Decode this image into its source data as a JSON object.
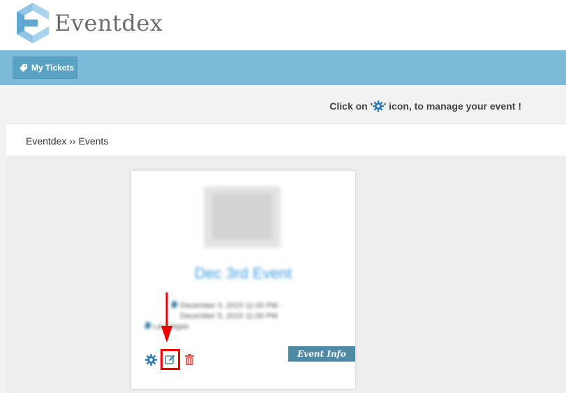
{
  "brand": {
    "name": "Eventdex",
    "colors": {
      "logo_light": "#a9d3ec",
      "logo_dark": "#5fa7d0",
      "nav": "#7dbad8",
      "button": "#5aa2c4",
      "event_info": "#4e89a6",
      "highlight": "#ee0000"
    }
  },
  "nav": {
    "my_tickets_label": "My Tickets",
    "my_tickets_icon": "ticket-icon"
  },
  "hint": {
    "prefix": "Click on '",
    "icon": "gear-icon",
    "suffix": "' icon, to manage your event !"
  },
  "breadcrumb": {
    "text": "Eventdex ›› Events"
  },
  "event_card": {
    "title": "Dec 3rd Event",
    "date_range_line1": "December 3, 2015 11:00 PM -",
    "date_range_line2": "December 5, 2015 11:00 PM",
    "location": "Las Vegas",
    "actions": [
      {
        "name": "manage",
        "icon": "gear-icon"
      },
      {
        "name": "edit",
        "icon": "edit-icon"
      },
      {
        "name": "delete",
        "icon": "trash-icon"
      }
    ],
    "event_info_label": "Event Info"
  }
}
